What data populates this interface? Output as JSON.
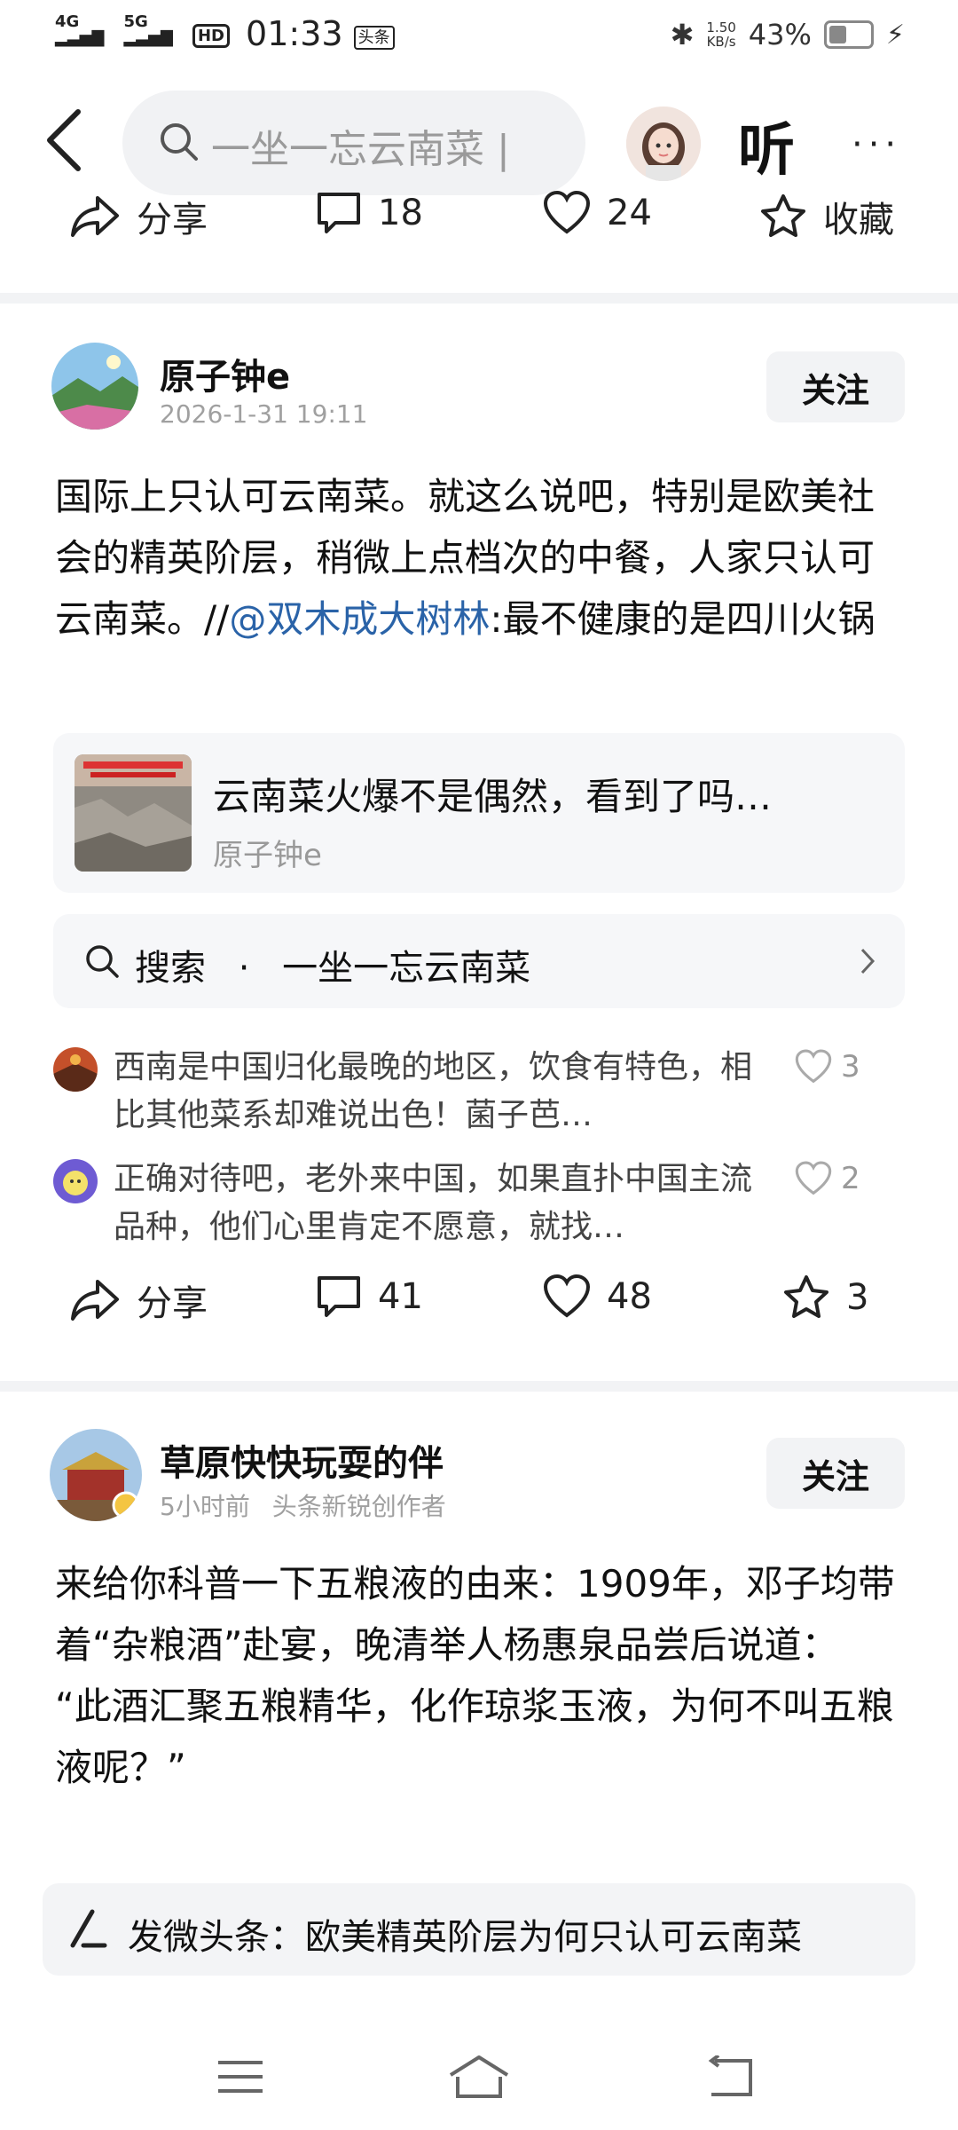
{
  "status_bar": {
    "network1": "4G",
    "network2": "5G",
    "hd": "HD",
    "time": "01:33",
    "app_badge": "头条",
    "speed_value": "1.50",
    "speed_unit": "KB/s",
    "battery": "43%",
    "battery_level": 0.43
  },
  "top_bar": {
    "search_placeholder": "一坐一忘云南菜 |",
    "listen_label": "听",
    "more_label": "···"
  },
  "prev_post_actions": {
    "share": "分享",
    "comments": "18",
    "likes": "24",
    "favorite": "收藏"
  },
  "post1": {
    "author": "原子钟e",
    "time": "2026-1-31 19:11",
    "follow": "关注",
    "text_part1": "国际上只认可云南菜。就这么说吧，特别是欧美社会的精英阶层，稍微上点档次的中餐，人家只认可云南菜。//",
    "mention": "@双木成大树林",
    "text_part2": ":最不健康的是四川火锅",
    "quote_title": "云南菜火爆不是偶然，看到了吗…",
    "quote_author": "原子钟e",
    "search_label": "搜索",
    "search_dot": "·",
    "search_query": "一坐一忘云南菜",
    "comments": [
      {
        "text": "西南是中国归化最晚的地区，饮食有特色，相比其他菜系却难说出色！菌子芭…",
        "likes": "3"
      },
      {
        "text": "正确对待吧，老外来中国，如果直扑中国主流品种，他们心里肯定不愿意，就找…",
        "likes": "2"
      }
    ],
    "actions": {
      "share": "分享",
      "comments": "41",
      "likes": "48",
      "favorites": "3"
    }
  },
  "post2": {
    "author": "草原快快玩耍的伴",
    "time": "5小时前",
    "badge": "头条新锐创作者",
    "follow": "关注",
    "text": "来给你科普一下五粮液的由来：1909年，邓子均带着“杂粮酒”赴宴，晚清举人杨惠泉品尝后说道：\n“此酒汇聚五粮精华，化作琼浆玉液，为何不叫五粮液呢？”"
  },
  "bottom_bar": {
    "compose_prefix": "发微头条：",
    "compose_topic": "欧美精英阶层为何只认可云南菜"
  },
  "colors": {
    "link": "#2a63a8",
    "divider": "#f2f3f5",
    "card": "#f6f7f9"
  }
}
